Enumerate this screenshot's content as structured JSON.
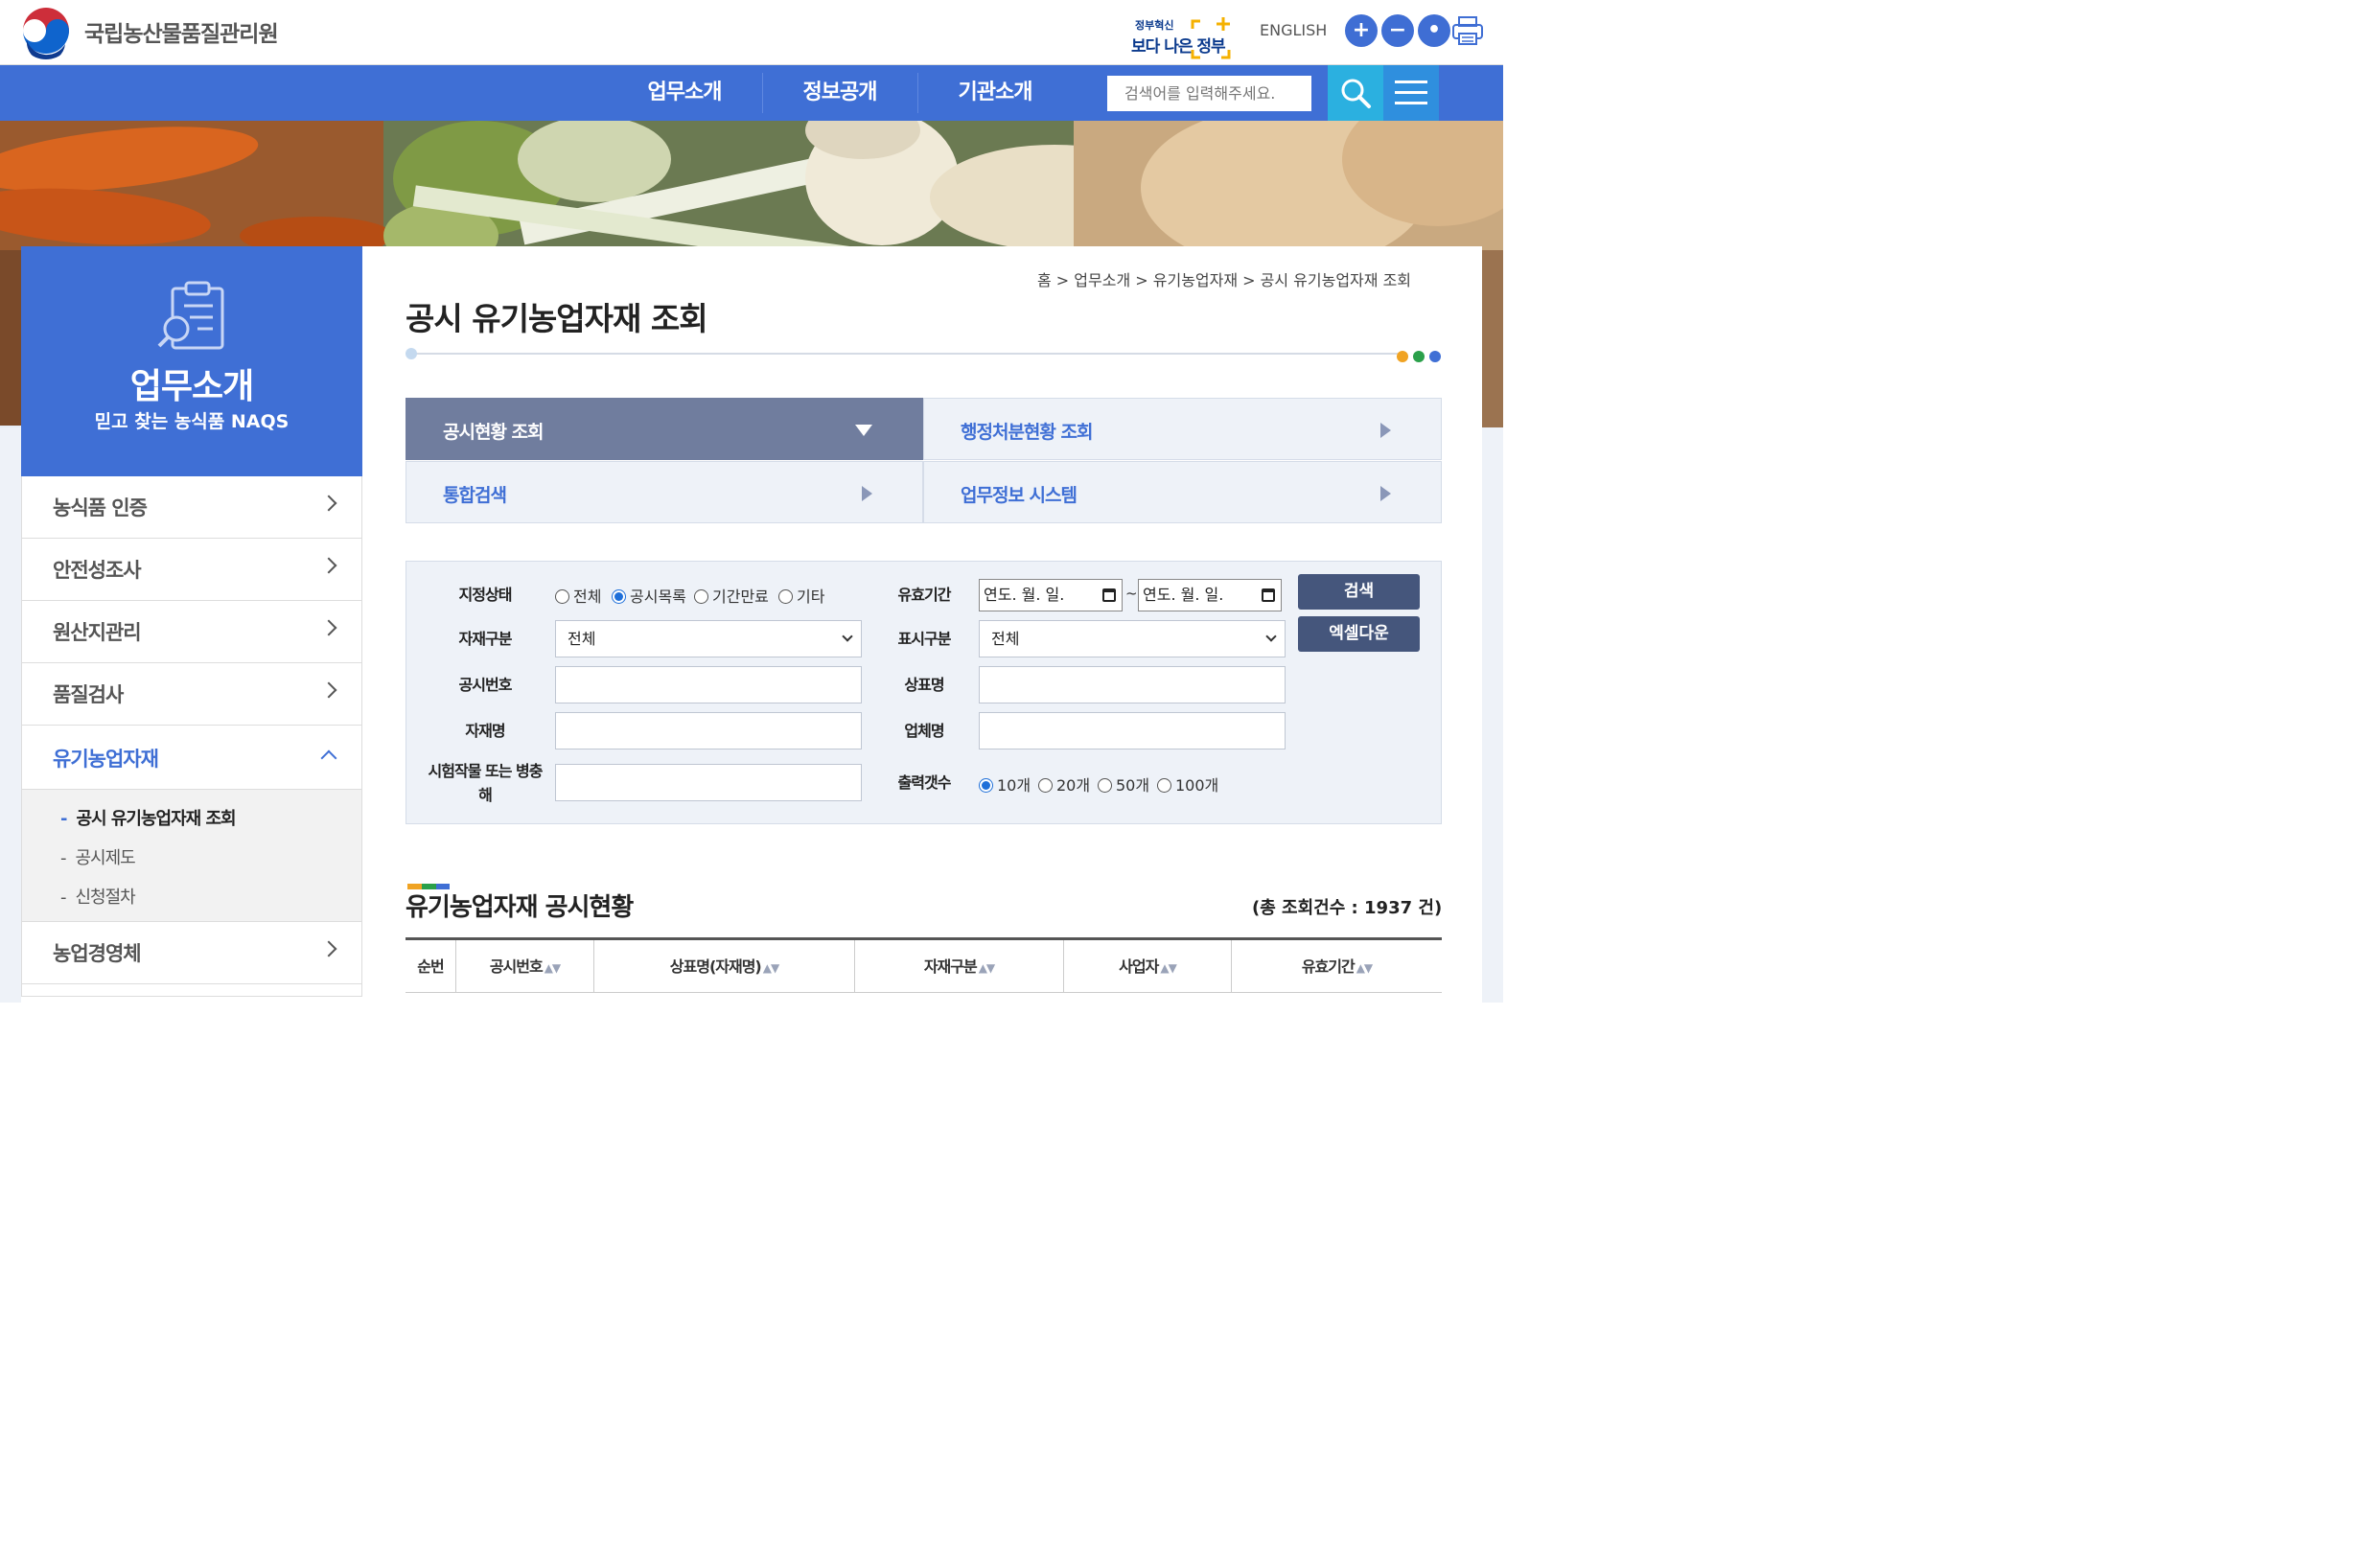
{
  "header": {
    "org_name": "국립농산물품질관리원",
    "gov_badge_small": "정부혁신",
    "gov_badge_big": "보다 나은 정부",
    "english_link": "ENGLISH",
    "zoom_in": "+",
    "zoom_out": "−",
    "zoom_reset": "•"
  },
  "nav": {
    "items": [
      "업무소개",
      "정보공개",
      "기관소개"
    ],
    "search_placeholder": "검색어를 입력해주세요."
  },
  "sidebar": {
    "title": "업무소개",
    "subtitle": "믿고 찾는 농식품 NAQS",
    "items": [
      "농식품 인증",
      "안전성조사",
      "원산지관리",
      "품질검사",
      "유기농업자재",
      "농업경영체"
    ],
    "active_index": 4,
    "submenu": [
      "공시 유기농업자재 조회",
      "공시제도",
      "신청절차"
    ],
    "submenu_dash": "-"
  },
  "breadcrumb": "홈 > 업무소개 > 유기농업자재 > 공시 유기농업자재 조회",
  "page_title": "공시 유기농업자재 조회",
  "tabs": [
    "공시현황 조회",
    "행정처분현황 조회",
    "통합검색",
    "업무정보 시스템"
  ],
  "form": {
    "labels": {
      "status": "지정상태",
      "material_type": "자재구분",
      "notice_no": "공시번호",
      "material_name": "자재명",
      "crop": "시험작물 또는 병충해",
      "valid_period": "유효기간",
      "display_type": "표시구분",
      "brand": "상표명",
      "company": "업체명",
      "output_count": "출력갯수"
    },
    "status_options": [
      "전체",
      "공시목록",
      "기간만료",
      "기타"
    ],
    "status_selected": "공시목록",
    "material_type_value": "전체",
    "display_type_value": "전체",
    "date_placeholder": "연도. 월. 일.",
    "date_sep": "~",
    "count_options": [
      "10개",
      "20개",
      "50개",
      "100개"
    ],
    "count_selected": "10개",
    "search_button": "검색",
    "excel_button": "엑셀다운"
  },
  "list": {
    "title": "유기농업자재 공시현황",
    "total": "(총 조회건수 : 1937 건)",
    "columns": [
      "순번",
      "공시번호",
      "상표명(자재명)",
      "자재구분",
      "사업자",
      "유효기간"
    ],
    "sort_glyph": "▲▼"
  },
  "colors": {
    "primary": "#3f6fd5",
    "search_btn": "#2bb0e0",
    "active_tab": "#707d9e",
    "button": "#45567c"
  }
}
